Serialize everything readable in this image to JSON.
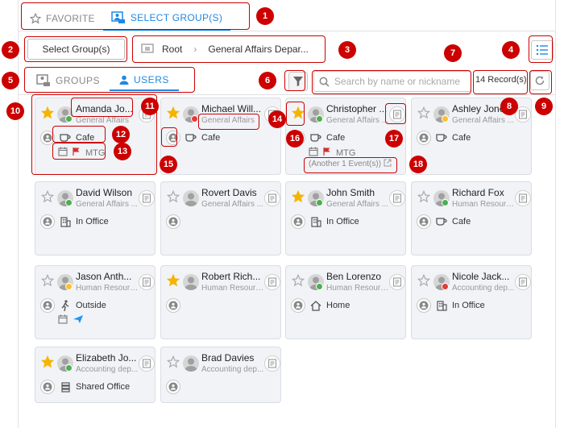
{
  "tabs": [
    {
      "label": "FAVORITE"
    },
    {
      "label": "SELECT GROUP(S)"
    }
  ],
  "select_group_label": "Select Group(s)",
  "breadcrumb": {
    "root": "Root",
    "current": "General Affairs Depar..."
  },
  "subtabs": [
    {
      "label": "GROUPS"
    },
    {
      "label": "USERS"
    }
  ],
  "search": {
    "placeholder": "Search by name or nickname"
  },
  "records": "14 Record(s)",
  "users": [
    {
      "name": "Amanda Jo...",
      "dept": "General Affairs",
      "star": true,
      "status": "#4caf50",
      "loc": "Cafe",
      "loc_icon": "cup",
      "event": "MTG",
      "has_cal": true
    },
    {
      "name": "Michael Will...",
      "dept": "General Affairs",
      "star": true,
      "status": "#e53935",
      "loc": "Cafe",
      "loc_icon": "cup"
    },
    {
      "name": "Christopher ...",
      "dept": "General Affairs ...",
      "star": true,
      "status": "#4caf50",
      "loc": "Cafe",
      "loc_icon": "cup",
      "event": "MTG",
      "has_cal": true,
      "more": "(Another 1 Event(s))"
    },
    {
      "name": "Ashley Jones",
      "dept": "General Affairs ...",
      "star": false,
      "status": "#fbc02d",
      "loc": "Cafe",
      "loc_icon": "cup"
    },
    {
      "name": "David Wilson",
      "dept": "General Affairs ...",
      "star": false,
      "status": "#4caf50",
      "loc": "In Office",
      "loc_icon": "building"
    },
    {
      "name": "Rovert Davis",
      "dept": "General Affairs ...",
      "star": false,
      "status": "",
      "loc": "",
      "loc_icon": ""
    },
    {
      "name": "John Smith",
      "dept": "General Affairs ...",
      "star": true,
      "status": "#4caf50",
      "loc": "In Office",
      "loc_icon": "building"
    },
    {
      "name": "Richard Fox",
      "dept": "Human Resourc...",
      "star": false,
      "status": "#4caf50",
      "loc": "Cafe",
      "loc_icon": "cup"
    },
    {
      "name": "Jason Anth...",
      "dept": "Human Resourc...",
      "star": false,
      "status": "#fbc02d",
      "loc": "Outside",
      "loc_icon": "walk",
      "has_cal": true,
      "plane": true
    },
    {
      "name": "Robert Rich...",
      "dept": "Human Resourc...",
      "star": true,
      "status": "",
      "loc": "",
      "loc_icon": ""
    },
    {
      "name": "Ben Lorenzo",
      "dept": "Human Resourc...",
      "star": false,
      "status": "#4caf50",
      "loc": "Home",
      "loc_icon": "home"
    },
    {
      "name": "Nicole Jack...",
      "dept": "Accounting dep...",
      "star": false,
      "status": "#e53935",
      "loc": "In Office",
      "loc_icon": "building"
    },
    {
      "name": "Elizabeth Jo...",
      "dept": "Accounting dep...",
      "star": true,
      "status": "#4caf50",
      "loc": "Shared Office",
      "loc_icon": "shared"
    },
    {
      "name": "Brad Davies",
      "dept": "Accounting dep...",
      "star": false,
      "status": "",
      "loc": "",
      "loc_icon": ""
    }
  ],
  "markers": [
    "1",
    "2",
    "3",
    "4",
    "5",
    "6",
    "7",
    "8",
    "9",
    "10",
    "11",
    "12",
    "13",
    "14",
    "15",
    "16",
    "17",
    "18"
  ],
  "colors": {
    "accent": "#1e88e5",
    "marker": "#cc0000",
    "star": "#f5b400",
    "card_bg": "#f1f3f7"
  }
}
